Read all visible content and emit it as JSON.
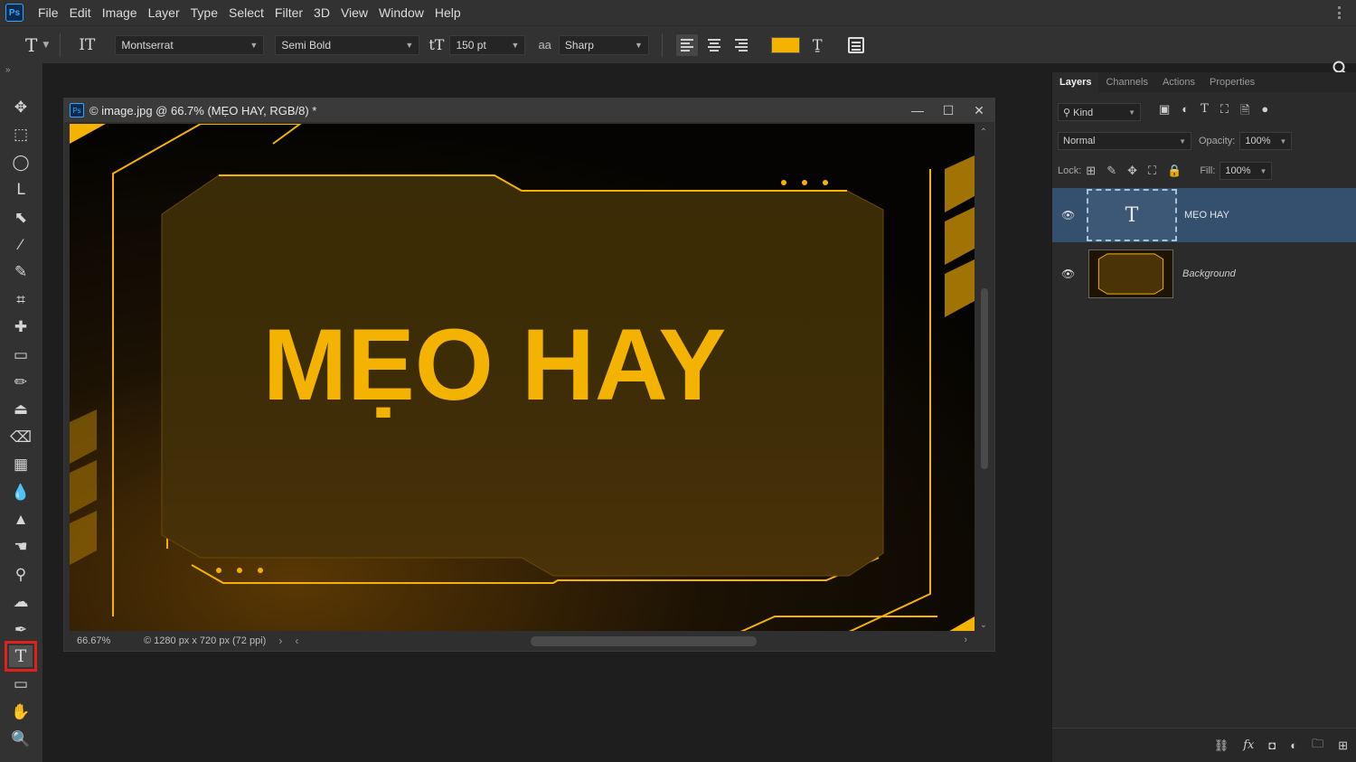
{
  "menubar": {
    "logo": "Ps",
    "items": [
      "File",
      "Edit",
      "Image",
      "Layer",
      "Type",
      "Select",
      "Filter",
      "3D",
      "View",
      "Window",
      "Help"
    ]
  },
  "options": {
    "tool_glyph": "T",
    "orient_glyph": "IT",
    "font_family": "Montserrat",
    "font_style": "Semi Bold",
    "size_glyph": "tT",
    "font_size": "150 pt",
    "aa_glyph": "aa",
    "antialias": "Sharp",
    "text_color": "#f5b301",
    "warp_glyph": "Ṯ",
    "icons": [
      "search-icon",
      "panel-toggle-icon"
    ]
  },
  "toolbar": {
    "collapse": "»",
    "tools": [
      {
        "name": "move-tool",
        "glyph": "✥"
      },
      {
        "name": "marquee-tool",
        "glyph": "⬚"
      },
      {
        "name": "ellipse-marquee-tool",
        "glyph": "◯"
      },
      {
        "name": "lasso-tool",
        "glyph": "ᒪ"
      },
      {
        "name": "object-select-tool",
        "glyph": "⬉"
      },
      {
        "name": "magic-wand-tool",
        "glyph": "⁄"
      },
      {
        "name": "quick-select-tool",
        "glyph": "✎"
      },
      {
        "name": "crop-tool",
        "glyph": "⌗"
      },
      {
        "name": "healing-brush-tool",
        "glyph": "✚"
      },
      {
        "name": "frame-tool",
        "glyph": "▭"
      },
      {
        "name": "brush-tool",
        "glyph": "✏"
      },
      {
        "name": "clone-stamp-tool",
        "glyph": "⏏"
      },
      {
        "name": "eraser-tool",
        "glyph": "⌫"
      },
      {
        "name": "gradient-tool",
        "glyph": "▦"
      },
      {
        "name": "blur-tool",
        "glyph": "💧"
      },
      {
        "name": "sharpen-tool",
        "glyph": "▲"
      },
      {
        "name": "smudge-tool",
        "glyph": "☚"
      },
      {
        "name": "dodge-tool",
        "glyph": "⚲"
      },
      {
        "name": "sponge-tool",
        "glyph": "☁"
      },
      {
        "name": "pen-tool",
        "glyph": "✒"
      },
      {
        "name": "type-tool",
        "glyph": "T"
      },
      {
        "name": "rectangle-tool",
        "glyph": "▭"
      },
      {
        "name": "hand-tool",
        "glyph": "✋"
      },
      {
        "name": "zoom-tool",
        "glyph": "🔍"
      }
    ],
    "selected_tool": "type-tool"
  },
  "document": {
    "ps_badge": "Ps",
    "title": "© image.jpg @ 66.7% (MẸO HAY, RGB/8) *",
    "win_minimize": "—",
    "win_maximize": "☐",
    "win_close": "✕",
    "canvas_text_main": "MẸO HAY",
    "status_zoom": "66.67%",
    "status_info": "© 1280 px x 720 px (72 ppi)",
    "status_arrow": "›",
    "scroll_left": "‹",
    "scroll_right": "›",
    "scroll_up": "⌃",
    "scroll_down": "⌄",
    "accent_color": "#f5b301"
  },
  "layers_panel": {
    "tabs": [
      "Layers",
      "Channels",
      "Actions",
      "Properties"
    ],
    "active_tab": "Layers",
    "filter_kind": "Kind",
    "blend_mode": "Normal",
    "opacity_label": "Opacity:",
    "opacity_value": "100%",
    "lock_label": "Lock:",
    "fill_label": "Fill:",
    "fill_value": "100%",
    "layers": [
      {
        "name": "MẸO HAY",
        "type": "text",
        "visible": true,
        "selected": true,
        "thumb_glyph": "T"
      },
      {
        "name": "Background",
        "type": "image",
        "visible": true,
        "selected": false
      }
    ],
    "footer_icons": [
      "link-icon",
      "fx-icon",
      "mask-icon",
      "adjustment-icon",
      "group-folder-icon",
      "new-layer-icon"
    ],
    "footer_glyphs": [
      "⛓",
      "fx",
      "◘",
      "◐",
      "🗀",
      "⊞"
    ]
  }
}
